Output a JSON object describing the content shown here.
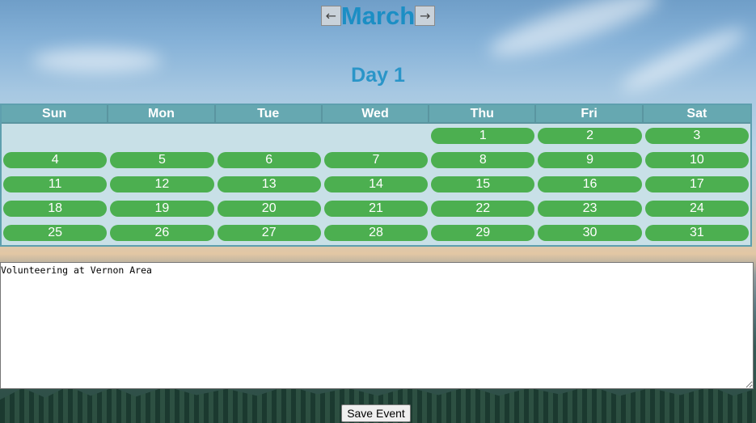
{
  "header": {
    "prev_label": "←",
    "month": "March",
    "next_label": "→"
  },
  "day_title": "Day 1",
  "calendar": {
    "weekdays": [
      "Sun",
      "Mon",
      "Tue",
      "Wed",
      "Thu",
      "Fri",
      "Sat"
    ],
    "weeks": [
      [
        "",
        "",
        "",
        "",
        "1",
        "2",
        "3"
      ],
      [
        "4",
        "5",
        "6",
        "7",
        "8",
        "9",
        "10"
      ],
      [
        "11",
        "12",
        "13",
        "14",
        "15",
        "16",
        "17"
      ],
      [
        "18",
        "19",
        "20",
        "21",
        "22",
        "23",
        "24"
      ],
      [
        "25",
        "26",
        "27",
        "28",
        "29",
        "30",
        "31"
      ]
    ]
  },
  "event": {
    "text": "Volunteering at Vernon Area",
    "save_label": "Save Event"
  },
  "colors": {
    "accent": "#1b8ec4",
    "day_pill": "#4caf50",
    "header_row": "#66a8b1",
    "grid_bg": "#c8e0e7"
  }
}
